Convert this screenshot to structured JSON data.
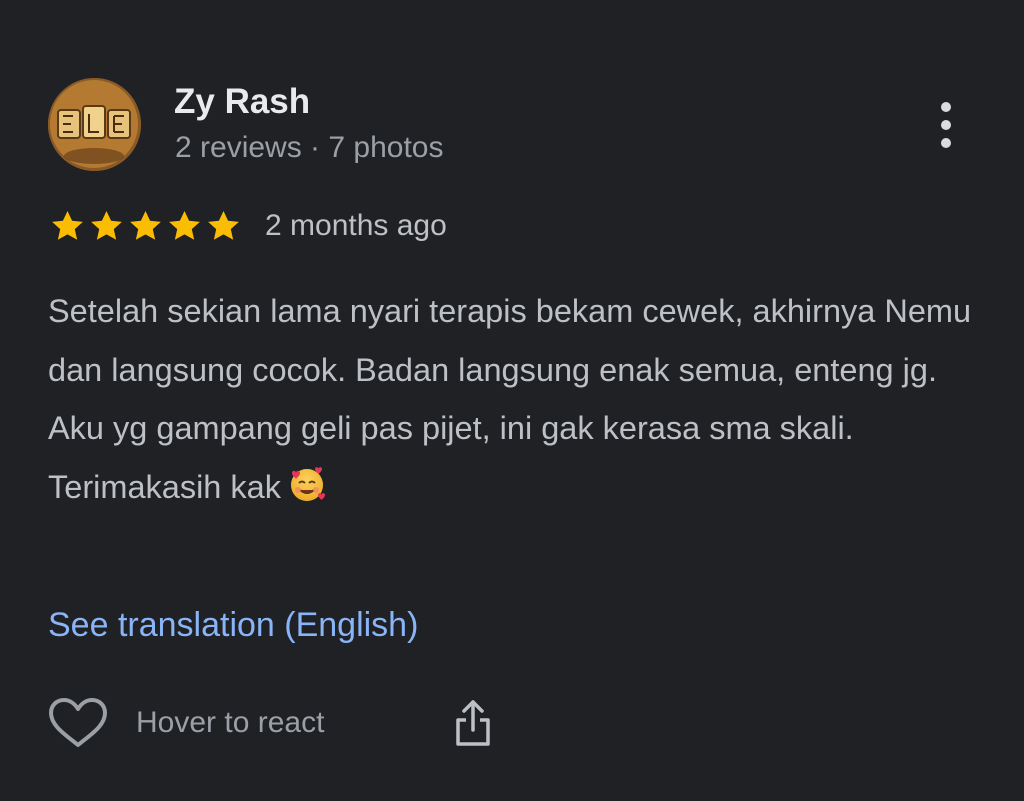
{
  "review": {
    "author": {
      "name": "Zy Rash",
      "meta": "2 reviews · 7 photos",
      "avatar_icon": "avatar-image"
    },
    "menu_icon": "more-vertical-icon",
    "rating": {
      "stars": 5,
      "max_stars": 5,
      "star_color": "#fbbc04",
      "time": "2 months ago"
    },
    "text": "Setelah sekian lama nyari terapis bekam cewek, akhirnya Nemu dan langsung cocok. Badan langsung enak semua, enteng jg. Aku yg gampang geli pas pijet, ini gak kerasa sma skali. Terimakasih kak",
    "emoji_icon": "smiling-face-with-hearts-emoji",
    "translate_label": "See translation (English)",
    "actions": {
      "react_label": "Hover to react",
      "react_icon": "heart-outline-icon",
      "share_icon": "share-icon"
    }
  },
  "colors": {
    "background": "#202124",
    "primary_text": "#e8eaed",
    "secondary_text": "#9aa0a6",
    "link": "#8ab4f8",
    "star": "#fbbc04"
  }
}
